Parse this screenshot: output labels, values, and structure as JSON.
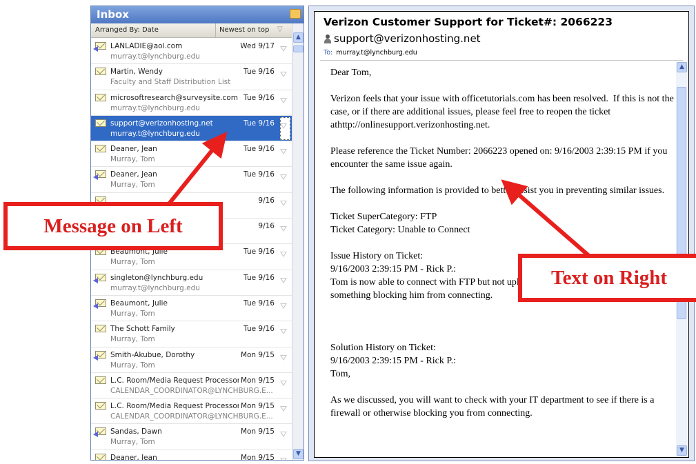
{
  "inbox": {
    "title": "Inbox",
    "arranged_by": "Arranged By: Date",
    "sort_order": "Newest on top",
    "messages": [
      {
        "from": "LANLADIE@aol.com",
        "sub": "murray.t@lynchburg.edu",
        "date": "Wed 9/17",
        "icon": "envelope-reply-icon",
        "selected": false
      },
      {
        "from": "Martin, Wendy",
        "sub": "Faculty and Staff Distribution List",
        "date": "Tue 9/16",
        "icon": "envelope-open-icon",
        "selected": false
      },
      {
        "from": "microsoftresearch@surveysite.com",
        "sub": "murray.t@lynchburg.edu",
        "date": "Tue 9/16",
        "icon": "envelope-open-icon",
        "selected": false
      },
      {
        "from": "support@verizonhosting.net",
        "sub": "murray.t@lynchburg.edu",
        "date": "Tue 9/16",
        "icon": "envelope-open-icon",
        "selected": true
      },
      {
        "from": "Deaner, Jean",
        "sub": "Murray, Tom",
        "date": "Tue 9/16",
        "icon": "envelope-open-icon",
        "selected": false
      },
      {
        "from": "Deaner, Jean",
        "sub": "Murray, Tom",
        "date": "Tue 9/16",
        "icon": "envelope-reply-icon",
        "selected": false
      },
      {
        "from": "",
        "sub": "",
        "date": "9/16",
        "icon": "envelope-open-icon",
        "selected": false
      },
      {
        "from": "",
        "sub": "",
        "date": "9/16",
        "icon": "envelope-open-icon",
        "selected": false
      },
      {
        "from": "Beaumont, Julie",
        "sub": "Murray, Tom",
        "date": "Tue 9/16",
        "icon": "envelope-open-icon",
        "selected": false
      },
      {
        "from": "singleton@lynchburg.edu",
        "sub": "murray.t@lynchburg.edu",
        "date": "Tue 9/16",
        "icon": "envelope-reply-icon",
        "selected": false
      },
      {
        "from": "Beaumont, Julie",
        "sub": "Murray, Tom",
        "date": "Tue 9/16",
        "icon": "envelope-reply-icon",
        "selected": false
      },
      {
        "from": "The Schott Family",
        "sub": "Murray, Tom",
        "date": "Tue 9/16",
        "icon": "envelope-open-icon",
        "selected": false
      },
      {
        "from": "Smith-Akubue, Dorothy",
        "sub": "Murray, Tom",
        "date": "Mon 9/15",
        "icon": "envelope-reply-icon",
        "selected": false
      },
      {
        "from": "L.C. Room/Media Request Processor",
        "sub": "CALENDAR_COORDINATOR@LYNCHBURG.E...",
        "date": "Mon 9/15",
        "icon": "envelope-open-icon",
        "selected": false
      },
      {
        "from": "L.C. Room/Media Request Processor",
        "sub": "CALENDAR_COORDINATOR@LYNCHBURG.E...",
        "date": "Mon 9/15",
        "icon": "envelope-open-icon",
        "selected": false
      },
      {
        "from": "Sandas, Dawn",
        "sub": "Murray, Tom",
        "date": "Mon 9/15",
        "icon": "envelope-reply-icon",
        "selected": false
      },
      {
        "from": "Deaner, Jean",
        "sub": "",
        "date": "Mon 9/15",
        "icon": "envelope-open-icon",
        "selected": false
      }
    ]
  },
  "reading": {
    "subject": "Verizon Customer Support for Ticket#: 2066223",
    "sender": "support@verizonhosting.net",
    "to_label": "To:",
    "to_value": "murray.t@lynchburg.edu",
    "body": [
      "Dear Tom,",
      "Verizon feels that your issue with officetutorials.com has been resolved.  If this is not the case, or if there are additional issues, please feel free to reopen the ticket athttp://onlinesupport.verizonhosting.net.",
      "Please reference the Ticket Number: 2066223 opened on: 9/16/2003 2:39:15 PM if you encounter the same issue again.",
      "The following information is provided to better assist you in preventing similar issues.",
      "Ticket SuperCategory: FTP\nTicket Category: Unable to Connect",
      "Issue History on Ticket:\n9/16/2003 2:39:15 PM - Rick P.:\nTom is now able to connect with FTP but not upload. It appears he has a firewall or something blocking him from connecting.",
      "",
      "Solution History on Ticket:\n9/16/2003 2:39:15 PM - Rick P.:\nTom,",
      "As we discussed, you will want to check with your IT department to see if there is a firewall or otherwise blocking you from connecting."
    ]
  },
  "annotations": {
    "left": "Message on Left",
    "right": "Text on Right",
    "color": "#e8201d"
  },
  "colors": {
    "selection": "#316ac5",
    "header": "#4f78c4"
  }
}
